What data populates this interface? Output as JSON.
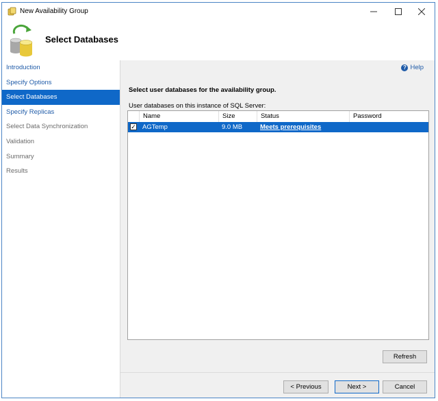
{
  "window": {
    "title": "New Availability Group",
    "accent": "#0f68c8"
  },
  "header": {
    "title": "Select Databases",
    "icon": "database-sync-icon"
  },
  "nav": {
    "items": [
      {
        "label": "Introduction",
        "state": "link"
      },
      {
        "label": "Specify Options",
        "state": "link"
      },
      {
        "label": "Select Databases",
        "state": "selected"
      },
      {
        "label": "Specify Replicas",
        "state": "link"
      },
      {
        "label": "Select Data Synchronization",
        "state": "disabled"
      },
      {
        "label": "Validation",
        "state": "disabled"
      },
      {
        "label": "Summary",
        "state": "disabled"
      },
      {
        "label": "Results",
        "state": "disabled"
      }
    ]
  },
  "content": {
    "help_label": "Help",
    "heading": "Select user databases for the availability group.",
    "subheading": "User databases on this instance of SQL Server:",
    "columns": [
      "Name",
      "Size",
      "Status",
      "Password"
    ],
    "rows": [
      {
        "name": "AGTemp",
        "size": "9.0 MB",
        "status": "Meets prerequisites",
        "password": "",
        "checked": true
      }
    ]
  },
  "buttons": {
    "refresh": "Refresh",
    "previous": "< Previous",
    "next": "Next >",
    "cancel": "Cancel"
  }
}
